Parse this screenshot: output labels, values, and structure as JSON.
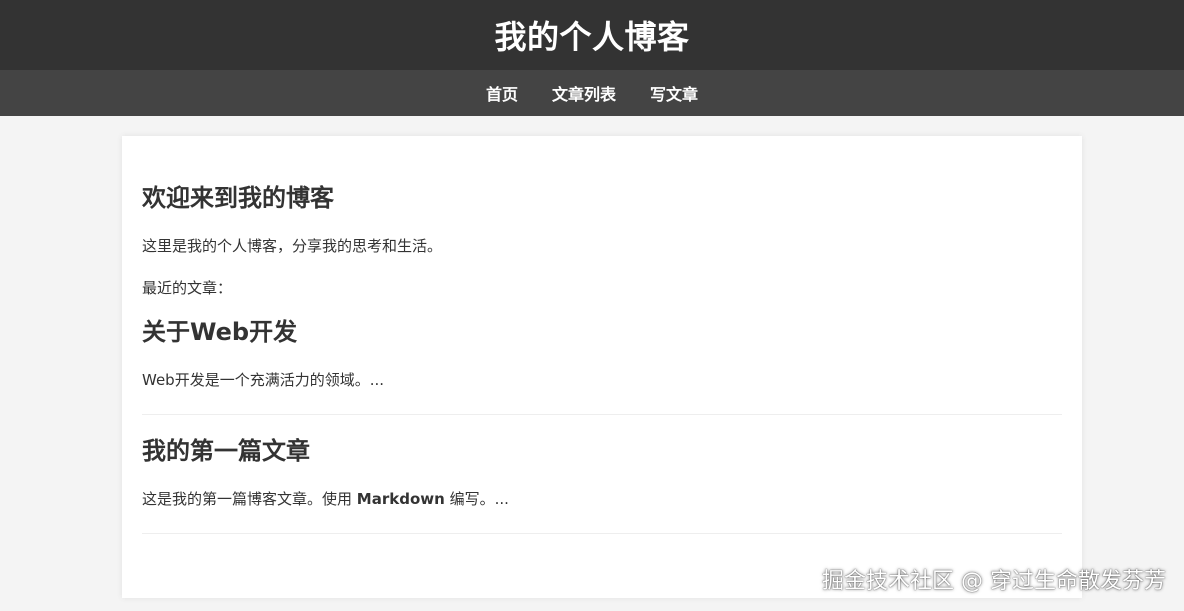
{
  "header": {
    "title": "我的个人博客"
  },
  "nav": {
    "items": [
      {
        "label": "首页"
      },
      {
        "label": "文章列表"
      },
      {
        "label": "写文章"
      }
    ]
  },
  "main": {
    "welcome_title": "欢迎来到我的博客",
    "intro": "这里是我的个人博客，分享我的思考和生活。",
    "recent_label": "最近的文章：",
    "posts": [
      {
        "title": "关于Web开发",
        "excerpt": "Web开发是一个充满活力的领域。..."
      },
      {
        "title": "我的第一篇文章",
        "excerpt_before": "这是我的第一篇博客文章。使用 ",
        "excerpt_bold": "Markdown",
        "excerpt_after": " 编写。..."
      }
    ]
  },
  "watermark": "掘金技术社区 @ 穿过生命散发芬芳",
  "colors": {
    "header_bg": "#333333",
    "nav_bg": "#444444",
    "page_bg": "#f4f4f4",
    "card_bg": "#ffffff",
    "text": "#333333"
  }
}
